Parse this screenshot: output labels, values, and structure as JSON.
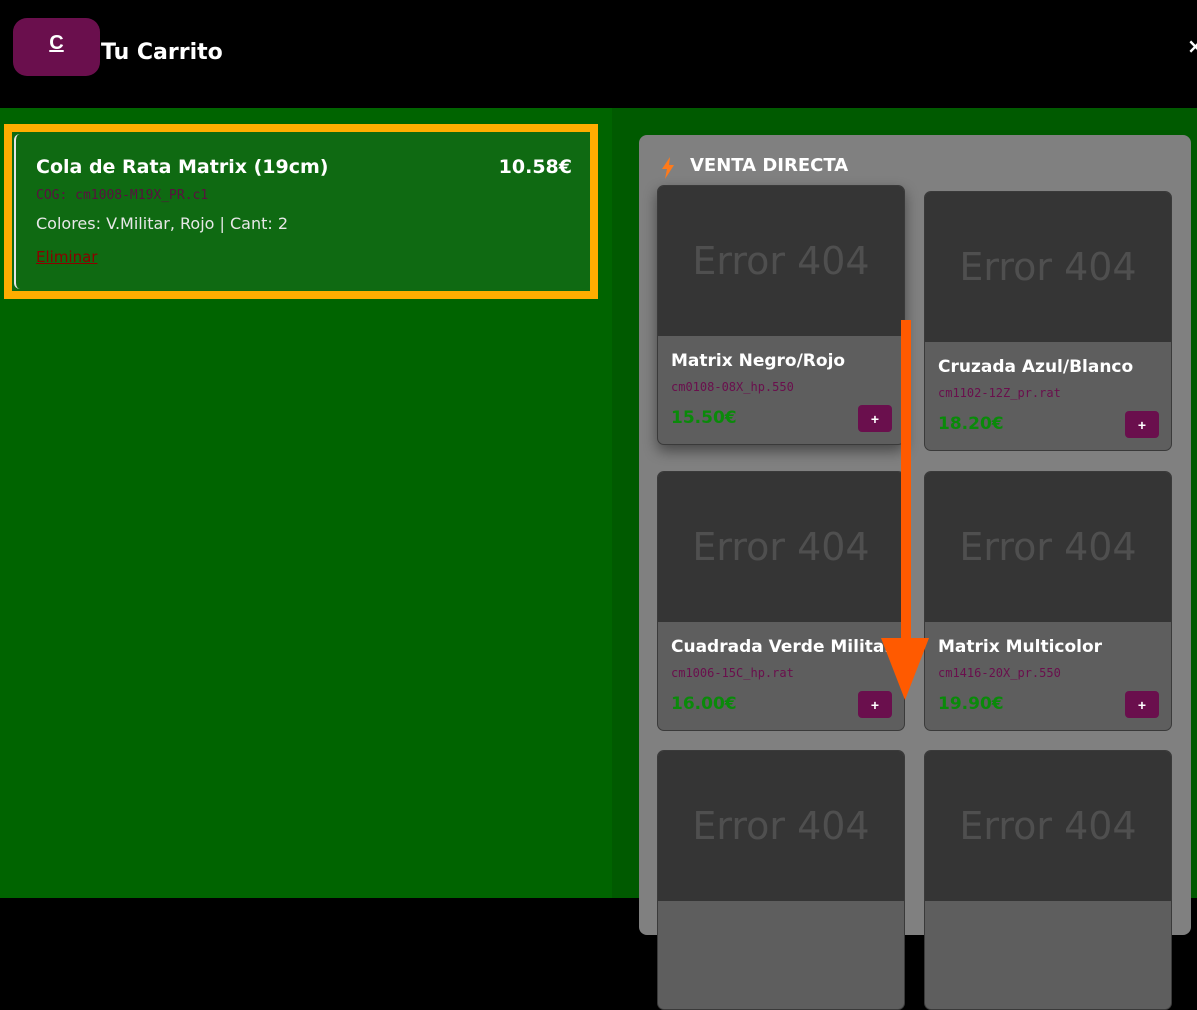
{
  "header": {
    "logo_label": "C",
    "title": "Tu Carrito",
    "close_label": "×"
  },
  "cart": {
    "items": [
      {
        "name": "Cola de Rata Matrix (19cm)",
        "price": "10.58€",
        "code": "COG: cm1008-M19X_PR.c1",
        "details": "Colores: V.Militar, Rojo | Cant: 2",
        "remove_label": "Eliminar"
      }
    ]
  },
  "shop": {
    "title": "VENTA DIRECTA",
    "title_icon": "lightning-icon",
    "products": [
      {
        "image_text": "Error 404",
        "name": "Matrix Negro/Rojo",
        "code": "cm0108-08X_hp.550",
        "price": "15.50€",
        "add_label": "+"
      },
      {
        "image_text": "Error 404",
        "name": "Cruzada Azul/Blanco",
        "code": "cm1102-12Z_pr.rat",
        "price": "18.20€",
        "add_label": "+"
      },
      {
        "image_text": "Error 404",
        "name": "Cuadrada Verde Militar",
        "code": "cm1006-15C_hp.rat",
        "price": "16.00€",
        "add_label": "+"
      },
      {
        "image_text": "Error 404",
        "name": "Matrix Multicolor",
        "code": "cm1416-20X_pr.550",
        "price": "19.90€",
        "add_label": "+"
      },
      {
        "image_text": "Error 404"
      },
      {
        "image_text": "Error 404"
      }
    ]
  },
  "colors": {
    "accent": "#6a0f4d",
    "highlight": "#ffad00",
    "arrow": "#ff5a00"
  }
}
